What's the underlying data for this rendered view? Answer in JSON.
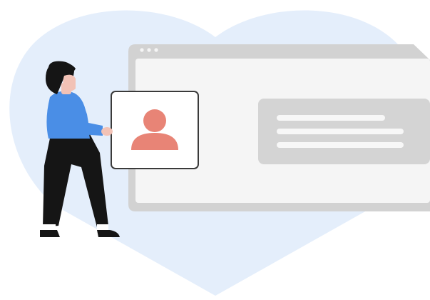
{
  "colors": {
    "heart": "#e4eefb",
    "browser_frame": "#d2d2d2",
    "browser_body": "#f5f5f5",
    "text_block": "#d4d4d4",
    "text_line": "#f7f7f7",
    "card_fill": "#ffffff",
    "card_border": "#3a3a3a",
    "avatar": "#e88476",
    "sweater": "#4a8ee6",
    "pants": "#151515",
    "hair": "#151515",
    "skin": "#f2c2b6",
    "shoes": "#151515",
    "socks": "#ffffff"
  },
  "icons": {
    "browser_dots": "three-dots-icon",
    "card_avatar": "user-avatar-icon"
  },
  "browser": {
    "dots_count": 3,
    "text_lines": 3
  }
}
